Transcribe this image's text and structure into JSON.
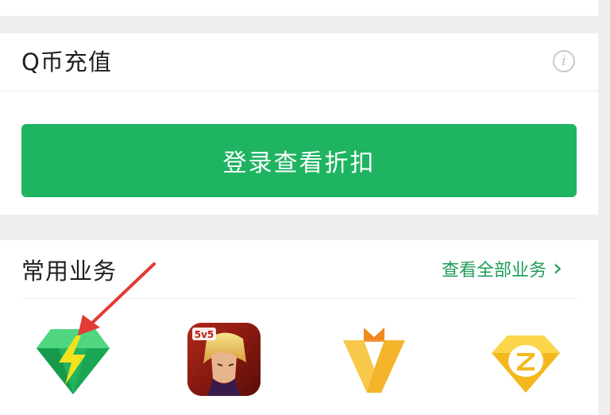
{
  "recharge": {
    "title": "Q币充值",
    "info_icon": "i",
    "login_button": "登录查看折扣"
  },
  "services": {
    "title": "常用业务",
    "view_all": "查看全部业务",
    "chevron": "›",
    "items": [
      {
        "icon": "green-gem-lightning-icon"
      },
      {
        "icon": "game-5v5-icon",
        "badge": "5v5"
      },
      {
        "icon": "orange-v-vip-icon"
      },
      {
        "icon": "yellow-z-diamond-icon"
      }
    ]
  },
  "colors": {
    "accent_green": "#1fb461",
    "link_green": "#1e9c57",
    "annotation_red": "#e23b34"
  }
}
